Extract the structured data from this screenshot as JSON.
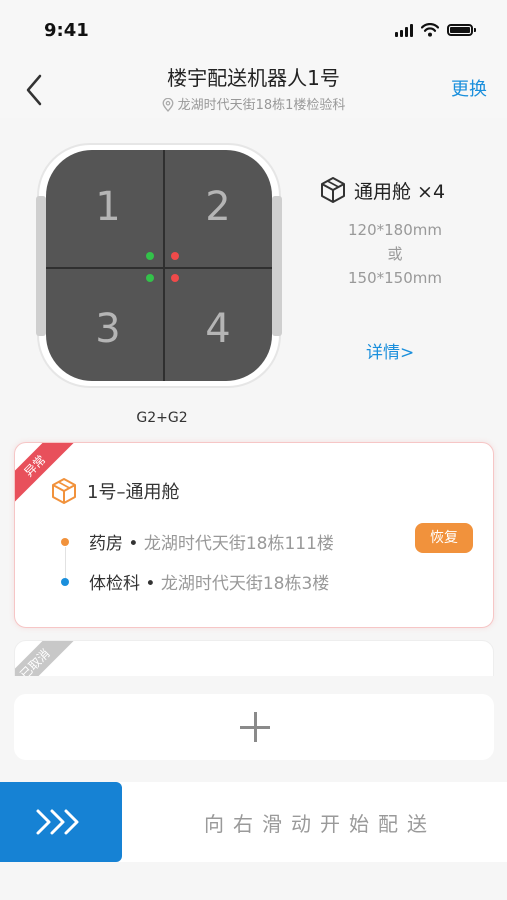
{
  "status_bar": {
    "time": "9:41"
  },
  "header": {
    "title": "楼宇配送机器人1号",
    "location": "龙湖时代天街18栋1楼检验科",
    "switch_label": "更换"
  },
  "robot": {
    "compartments": [
      "1",
      "2",
      "3",
      "4"
    ],
    "model": "G2+G2",
    "cabin_label": "通用舱 ×4",
    "size_line1": "120*180mm",
    "size_or": "或",
    "size_line2": "150*150mm",
    "details_link": "详情>",
    "indicator_colors": {
      "green": "#33c24a",
      "red": "#ef4a4a"
    }
  },
  "task_cards": [
    {
      "status": "异常",
      "title": "1号–通用舱",
      "from_name": "药房",
      "from_addr": "龙湖时代天街18栋111楼",
      "to_name": "体检科",
      "to_addr": "龙湖时代天街18栋3楼",
      "action_label": "恢复"
    },
    {
      "status": "已取消"
    }
  ],
  "slider": {
    "label": "向右滑动开始配送"
  },
  "colors": {
    "accent": "#1a8fdc",
    "warning": "#f1923c",
    "error": "#e8505b"
  }
}
